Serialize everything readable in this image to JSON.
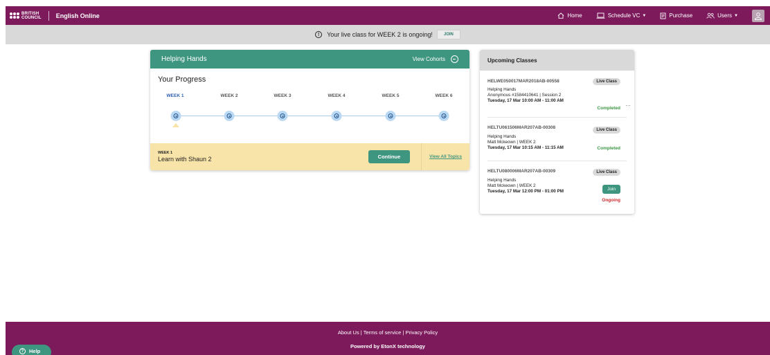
{
  "header": {
    "logo_text_line1": "BRITISH",
    "logo_text_line2": "COUNCIL",
    "app_name": "English Online",
    "nav": {
      "home": "Home",
      "schedule": "Schedule VC",
      "purchase": "Purchase",
      "users": "Users"
    }
  },
  "notice": {
    "text": "Your live class for WEEK 2 is ongoing!",
    "join_label": "JOIN",
    "icon": "info-icon"
  },
  "progress_card": {
    "cohort_name": "Helping Hands",
    "view_cohorts_label": "View Cohorts",
    "title": "Your Progress",
    "weeks": [
      "WEEK 1",
      "WEEK 2",
      "WEEK 3",
      "WEEK 4",
      "WEEK 5",
      "WEEK 6"
    ],
    "active_week_index": 0,
    "current_topic": {
      "week": "WEEK 1",
      "name": "Learn with Shaun 2",
      "continue_label": "Continue",
      "view_all_label": "View All Topics"
    }
  },
  "upcoming": {
    "title": "Upcoming Classes",
    "classes": [
      {
        "id": "HELWE050017MAR2018AB-00558",
        "badge": "Live Class",
        "course": "Helping Hands",
        "desc": "Anonymous #1584410641 | Session 2",
        "time": "Tuesday, 17 Mar 10:00 AM - 11:00 AM",
        "status": "Completed"
      },
      {
        "id": "HELTU061506MAR207AB-00308",
        "badge": "Live Class",
        "course": "Helping Hands",
        "desc": "Matt Mckeown | WEEK 2",
        "time": "Tuesday, 17 Mar 10:15 AM - 11:15 AM",
        "status": "Completed"
      },
      {
        "id": "HELTU080006MAR207AB-00309",
        "badge": "Live Class",
        "course": "Helping Hands",
        "desc": "Matt Mckeown | WEEK 2",
        "time": "Tuesday, 17 Mar 12:00 PM - 01:00 PM",
        "join_label": "Join",
        "status": "Ongoing"
      }
    ]
  },
  "footer": {
    "about": "About Us",
    "terms": "Terms of service",
    "privacy": "Privacy Policy",
    "separator": "|",
    "powered": "Powered by EtonX technology"
  },
  "help": {
    "label": "Help"
  },
  "colors": {
    "brand": "#7c1a5c",
    "accent": "#3f9680",
    "topic_bg": "#f8e3a8",
    "completed": "#3c9442",
    "ongoing": "#cc2727"
  }
}
